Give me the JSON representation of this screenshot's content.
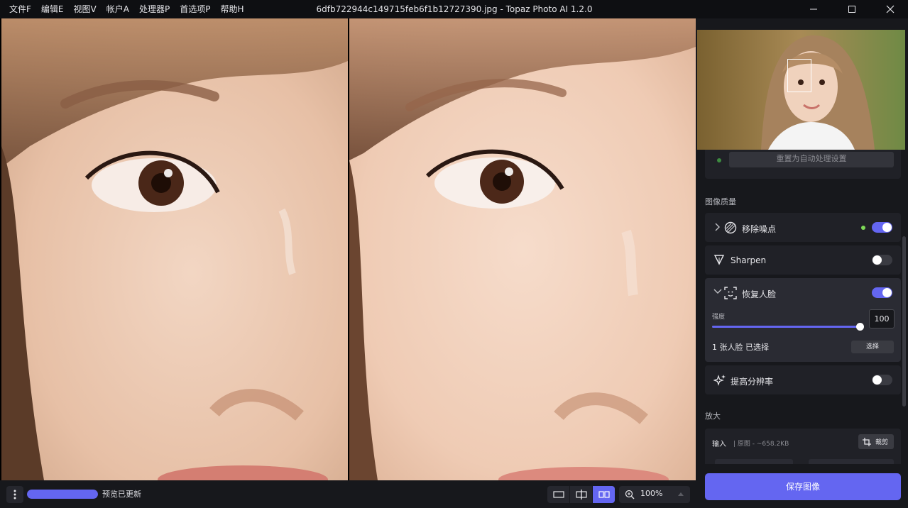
{
  "menu": [
    {
      "label": "文件F"
    },
    {
      "label": "编辑E"
    },
    {
      "label": "视图V"
    },
    {
      "label": "帐户A"
    },
    {
      "label": "处理器P"
    },
    {
      "label": "首选项P"
    },
    {
      "label": "帮助H"
    }
  ],
  "window": {
    "title": "6dfb722944c149715feb6f1b12727390.jpg - Topaz Photo AI 1.2.0"
  },
  "bottom": {
    "progress": 1.0,
    "status": "预览已更新",
    "zoom": "100%",
    "active_view": "side-by-side"
  },
  "panel": {
    "auto_button": "重置为自动处理设置",
    "quality_title": "图像质量",
    "denoise": {
      "label": "移除噪点",
      "enabled": true
    },
    "sharpen": {
      "label": "Sharpen",
      "enabled": false
    },
    "face": {
      "label": "恢复人脸",
      "enabled": true,
      "strength_label": "强度",
      "strength": 100,
      "strength_max": 100,
      "faces_selected": "1 张人脸 已选择",
      "select_button": "选择"
    },
    "upscale_toggle": {
      "label": "提高分辨率",
      "enabled": false
    },
    "enlarge_title": "放大",
    "input": {
      "label": "输入",
      "size": "| 原图 - ~658.2KB",
      "crop_button": "裁剪"
    },
    "save_button": "保存图像"
  },
  "colors": {
    "accent": "#6466f1",
    "panel_bg": "#17181c",
    "card_bg": "#202127",
    "green_dot": "#7ed957"
  }
}
